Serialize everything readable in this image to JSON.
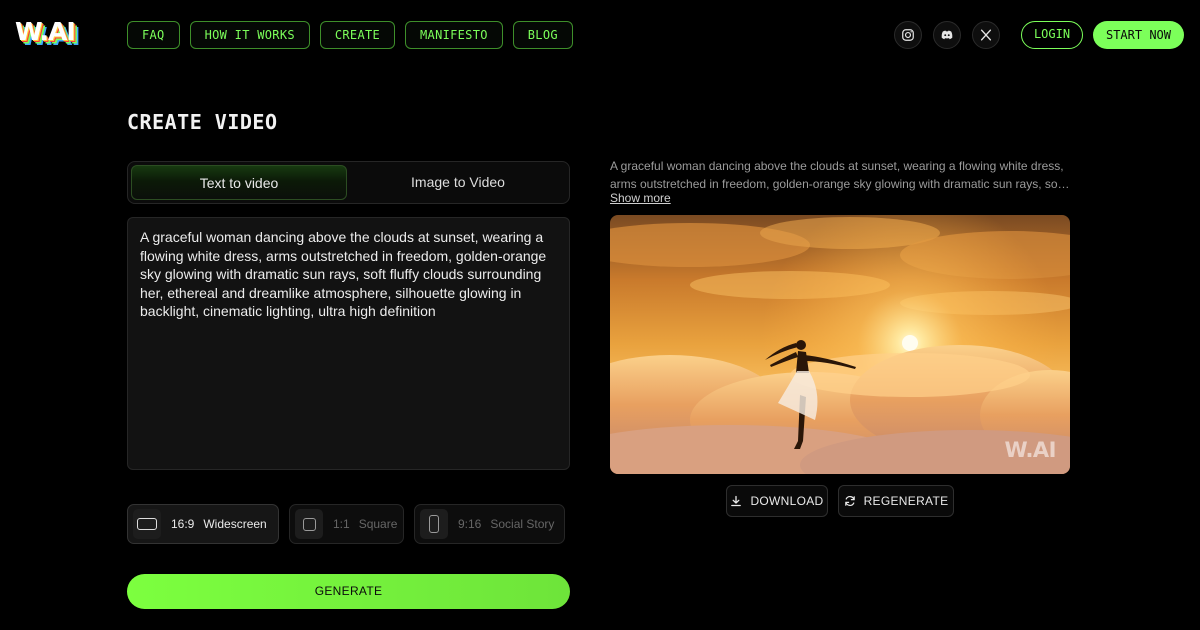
{
  "brand": {
    "logo": "W.AI",
    "watermark": "W.AI"
  },
  "nav": [
    {
      "label": "FAQ"
    },
    {
      "label": "HOW IT WORKS"
    },
    {
      "label": "CREATE"
    },
    {
      "label": "MANIFESTO"
    },
    {
      "label": "BLOG"
    }
  ],
  "social": [
    "instagram-icon",
    "discord-icon",
    "x-icon"
  ],
  "header": {
    "login_label": "LOGIN",
    "start_label": "START NOW"
  },
  "page": {
    "title": "CREATE VIDEO"
  },
  "tabs": [
    {
      "label": "Text to video",
      "active": true
    },
    {
      "label": "Image to Video",
      "active": false
    }
  ],
  "prompt": {
    "value": "A graceful woman dancing above the clouds at sunset, wearing a flowing white dress, arms outstretched in freedom, golden-orange sky glowing with dramatic sun rays, soft fluffy clouds surrounding her, ethereal and dreamlike atmosphere, silhouette glowing in backlight, cinematic lighting, ultra high definition"
  },
  "ratios": [
    {
      "value": "16:9",
      "name": "Widescreen",
      "selected": true
    },
    {
      "value": "1:1",
      "name": "Square",
      "selected": false
    },
    {
      "value": "9:16",
      "name": "Social Story",
      "selected": false
    }
  ],
  "generate_label": "GENERATE",
  "preview": {
    "prompt_line1": "A graceful woman dancing above the clouds at sunset, wearing a flowing white dress,",
    "prompt_line2": "arms outstretched in freedom, golden-orange sky glowing with dramatic sun rays, soft...",
    "show_more_label": "Show more",
    "download_label": "DOWNLOAD",
    "regenerate_label": "REGENERATE"
  },
  "colors": {
    "accent": "#7cff5a",
    "background": "#000000",
    "panel": "#121212"
  }
}
